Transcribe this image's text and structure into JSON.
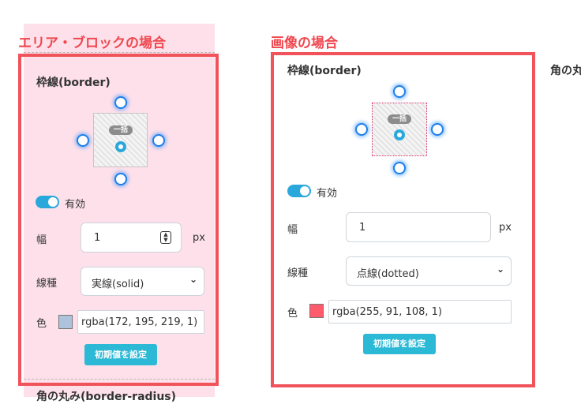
{
  "left": {
    "heading": "エリア・ブロックの場合",
    "section_title": "枠線(border)",
    "center_badge": "一括",
    "toggle_label": "有効",
    "width_label": "幅",
    "width_value": "1",
    "unit_label": "px",
    "style_label": "線種",
    "style_value": "実線(solid)",
    "color_label": "色",
    "color_value": "rgba(172, 195, 219, 1)",
    "color_swatch": "#acc3db",
    "reset_button": "初期値を設定",
    "next_section_title": "角の丸み(border-radius)"
  },
  "right": {
    "heading": "画像の場合",
    "section_title": "枠線(border)",
    "center_badge": "一括",
    "toggle_label": "有効",
    "width_label": "幅",
    "width_value": "1",
    "unit_label": "px",
    "style_label": "線種",
    "style_value": "点線(dotted)",
    "color_label": "色",
    "color_value": "rgba(255, 91, 108, 1)",
    "color_swatch": "#ff5b6c",
    "reset_button": "初期値を設定"
  },
  "far_right": {
    "section_title": "角の丸み"
  },
  "colors": {
    "accent_red": "#f0474e",
    "accent_cyan": "#2cb9d6",
    "panel_pink": "#fde0ea"
  }
}
